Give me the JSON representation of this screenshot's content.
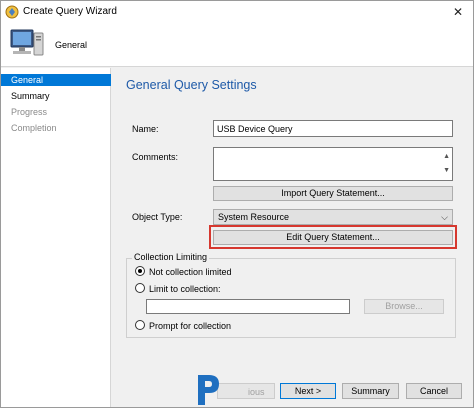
{
  "window": {
    "title": "Create Query Wizard",
    "close_glyph": "✕"
  },
  "header": {
    "title": "General"
  },
  "sidebar": {
    "items": [
      {
        "label": "General",
        "state": "active"
      },
      {
        "label": "Summary",
        "state": "normal"
      },
      {
        "label": "Progress",
        "state": "disabled"
      },
      {
        "label": "Completion",
        "state": "disabled"
      }
    ]
  },
  "main": {
    "heading": "General Query Settings",
    "name_label": "Name:",
    "name_value": "USB Device Query",
    "comments_label": "Comments:",
    "comments_value": "",
    "import_button": "Import Query Statement...",
    "object_type_label": "Object Type:",
    "object_type_value": "System Resource",
    "edit_button": "Edit Query Statement...",
    "collection_limiting": {
      "title": "Collection Limiting",
      "options": [
        {
          "label": "Not collection limited",
          "checked": true
        },
        {
          "label": "Limit to collection:",
          "checked": false
        },
        {
          "label": "Prompt for collection",
          "checked": false
        }
      ],
      "collection_value": "",
      "browse_button": "Browse..."
    }
  },
  "footer": {
    "previous_partial": "ious",
    "next_button": "Next >",
    "summary_button": "Summary",
    "cancel_button": "Cancel"
  },
  "colors": {
    "accent": "#0078d7",
    "heading": "#1e5aa8",
    "highlight_box": "#d6382f"
  }
}
